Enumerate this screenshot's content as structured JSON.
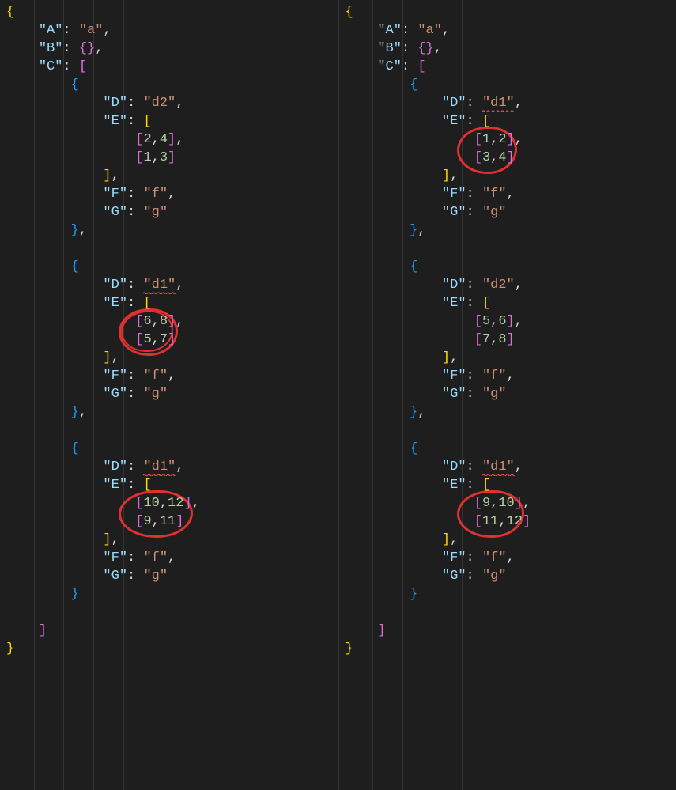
{
  "panes": [
    {
      "id": "left",
      "json": {
        "A": "a",
        "B": {},
        "C": [
          {
            "D": "d2",
            "E": [
              [
                2,
                4
              ],
              [
                1,
                3
              ]
            ],
            "F": "f",
            "G": "g",
            "D_squiggle": false,
            "E_circled": false
          },
          {
            "D": "d1",
            "E": [
              [
                6,
                8
              ],
              [
                5,
                7
              ]
            ],
            "F": "f",
            "G": "g",
            "D_squiggle": true,
            "E_circled": true,
            "circle_double": true
          },
          {
            "D": "d1",
            "E": [
              [
                10,
                12
              ],
              [
                9,
                11
              ]
            ],
            "F": "f",
            "G": "g",
            "D_squiggle": true,
            "E_circled": true,
            "circle_double": false
          }
        ]
      }
    },
    {
      "id": "right",
      "json": {
        "A": "a",
        "B": {},
        "C": [
          {
            "D": "d1",
            "E": [
              [
                1,
                2
              ],
              [
                3,
                4
              ]
            ],
            "F": "f",
            "G": "g",
            "D_squiggle": true,
            "E_circled": true,
            "circle_double": false
          },
          {
            "D": "d2",
            "E": [
              [
                5,
                6
              ],
              [
                7,
                8
              ]
            ],
            "F": "f",
            "G": "g",
            "D_squiggle": false,
            "E_circled": false
          },
          {
            "D": "d1",
            "E": [
              [
                9,
                10
              ],
              [
                11,
                12
              ]
            ],
            "F": "f",
            "G": "g",
            "D_squiggle": true,
            "E_circled": true,
            "circle_double": false
          }
        ]
      }
    }
  ],
  "indent_unit": "    ",
  "colors": {
    "annotation_red": "#e03131",
    "background": "#1e1e1e"
  }
}
